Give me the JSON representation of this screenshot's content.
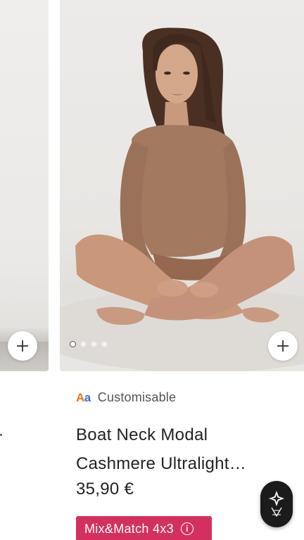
{
  "left_card": {
    "add_button_icon": "plus-icon"
  },
  "main_card": {
    "add_button_icon": "plus-icon",
    "carousel": {
      "total_dots": 4,
      "active_index": 0
    }
  },
  "product": {
    "customisable_label": "Customisable",
    "customisable_icon_text": "Aa",
    "title_line1": "Boat Neck Modal",
    "title_line2": "Cashmere Ultralight…",
    "price": "35,90 €",
    "promo_label": "Mix&Match 4x3",
    "promo_info_icon": "i"
  },
  "brand_fab": {
    "icon": "brand-emblem-icon"
  },
  "colors": {
    "promo_bg": "#d4305e",
    "fab_bg": "#1b1b1b",
    "skin_top": "#a37a60"
  }
}
